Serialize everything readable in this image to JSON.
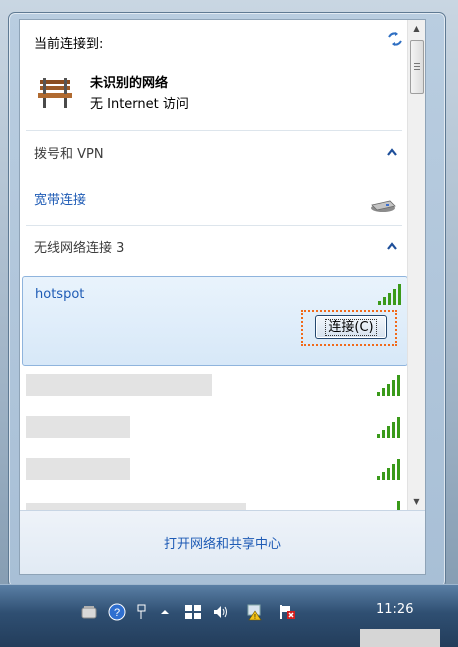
{
  "popup": {
    "header_title": "当前连接到:",
    "current_network": {
      "name": "未识别的网络",
      "status": "无 Internet 访问",
      "icon": "bench-network-icon"
    },
    "sections": [
      {
        "title": "拨号和 VPN",
        "toggle": "collapse-up-arrow"
      },
      {
        "title": "无线网络连接 3",
        "toggle": "collapse-up-arrow"
      }
    ],
    "dialup_items": [
      {
        "label": "宽带连接",
        "icon": "modem-icon"
      }
    ],
    "wireless_selected": {
      "ssid": "hotspot",
      "connect_label": "连接(C)",
      "highlight_color": "#f06a1b"
    },
    "footer_link": "打开网络和共享中心"
  },
  "taskbar": {
    "time": "11:26",
    "tray_icons": [
      "notes-icon",
      "help-icon",
      "pin-icon",
      "show-hidden-icons-arrow",
      "flag-icon",
      "volume-icon",
      "network-warning-icon",
      "action-center-error-icon"
    ]
  },
  "colors": {
    "link": "#1e5bb5",
    "selection_bg": "#d7e8f8",
    "taskbar": "#2f4f72"
  }
}
